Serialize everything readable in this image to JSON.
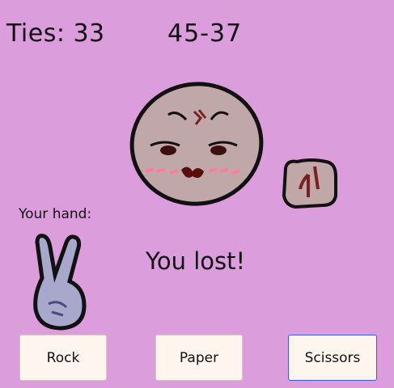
{
  "scoreboard": {
    "ties": "Ties: 33",
    "score": "45-37"
  },
  "opponent": {
    "face_icon": "smug-face-icon",
    "hand_icon": "rock-fist-icon"
  },
  "player": {
    "label": "Your hand:",
    "hand_icon": "peace-sign-hand-icon"
  },
  "result": {
    "text": "You lost!"
  },
  "buttons": {
    "rock": "Rock",
    "paper": "Paper",
    "scissors": "Scissors"
  },
  "colors": {
    "background": "#dc9ddc",
    "button_bg": "#fff5ef",
    "focused_border": "#3b5bdb"
  }
}
